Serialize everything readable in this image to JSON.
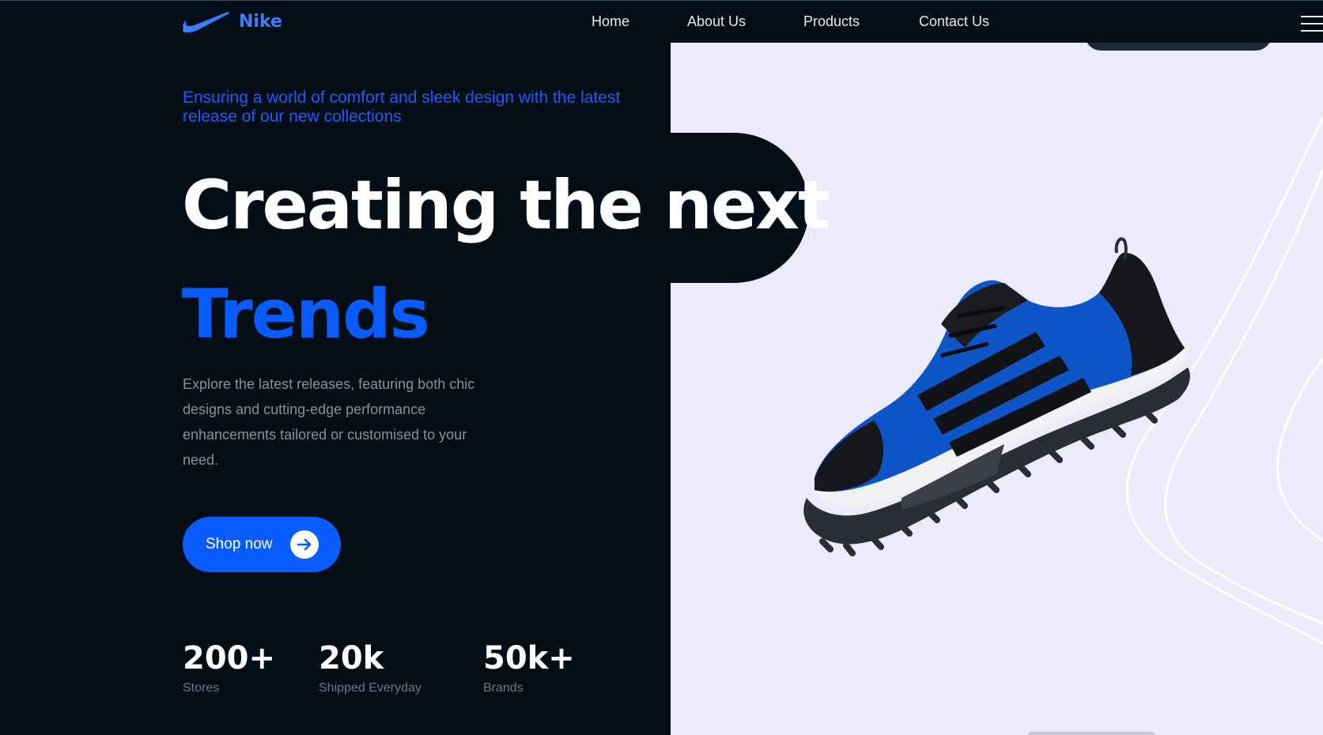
{
  "brand": {
    "name": "Nike",
    "accent": "#0a5cff",
    "logo_icon": "swoosh-icon"
  },
  "nav": {
    "items": [
      {
        "label": "Home"
      },
      {
        "label": "About Us"
      },
      {
        "label": "Products"
      },
      {
        "label": "Contact Us"
      }
    ],
    "menu_icon": "hamburger-menu-icon"
  },
  "hero": {
    "tagline": "Ensuring a world of comfort and sleek design with the latest release of our new collections",
    "headline_line1": "Creating the next",
    "headline_line2": "Trends",
    "description": "Explore the latest releases, featuring both chic designs and cutting-edge performance enhancements tailored or customised to your need.",
    "cta_label": "Shop now",
    "cta_icon": "arrow-right-icon",
    "image_icon": "sneaker-image"
  },
  "stats": [
    {
      "value": "200+",
      "label": "Stores"
    },
    {
      "value": "20k",
      "label": "Shipped Everyday"
    },
    {
      "value": "50k+",
      "label": "Brands"
    }
  ],
  "colors": {
    "background": "#040e17",
    "panel": "#ebebfb",
    "headline_accent": "#0a5cff",
    "tagline": "#1c5cff"
  }
}
